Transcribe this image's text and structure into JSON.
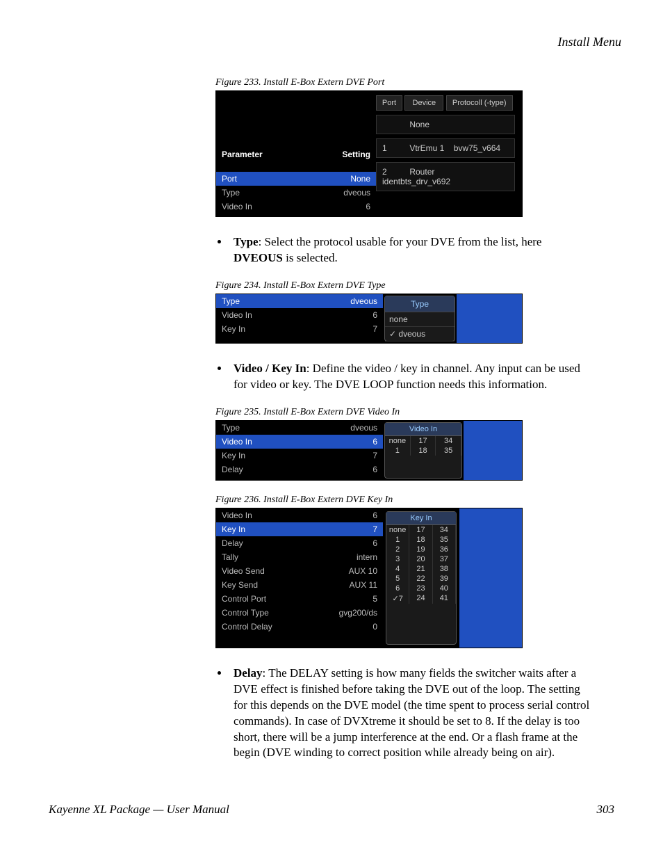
{
  "header": {
    "section_title": "Install Menu"
  },
  "fig233": {
    "caption": "Figure 233.  Install E-Box Extern DVE Port",
    "col_param": "Parameter",
    "col_setting": "Setting",
    "rows": [
      {
        "label": "Port",
        "value": "None",
        "selected": true
      },
      {
        "label": "Type",
        "value": "dveous",
        "selected": false
      },
      {
        "label": "Video In",
        "value": "6",
        "selected": false
      }
    ],
    "hdr_port": "Port",
    "hdr_device": "Device",
    "hdr_protocol": "Protocoll (-type)",
    "options": [
      {
        "port": "",
        "device": "None",
        "proto": ""
      },
      {
        "port": "1",
        "device": "VtrEmu 1",
        "proto": "bvw75_v664"
      },
      {
        "port": "2",
        "device": "Router",
        "proto": "identbts_drv_v692"
      }
    ]
  },
  "para_type": {
    "lead": "Type",
    "rest": ": Select the protocol usable for your DVE from the list, here ",
    "bold2": "DVEOUS",
    "rest2": " is selected."
  },
  "fig234": {
    "caption": "Figure 234.  Install E-Box Extern DVE Type",
    "rows": [
      {
        "label": "Type",
        "value": "dveous",
        "selected": true
      },
      {
        "label": "Video In",
        "value": "6",
        "selected": false
      },
      {
        "label": "Key In",
        "value": "7",
        "selected": false
      }
    ],
    "panel_title": "Type",
    "opt_none": "none",
    "opt_sel": "✓ dveous"
  },
  "para_videokey": {
    "lead": "Video / Key In",
    "rest": ": Define the video / key in channel. Any input can be used for video or key. The DVE LOOP function needs this information."
  },
  "fig235": {
    "caption": "Figure 235.  Install E-Box Extern DVE Video In",
    "rows": [
      {
        "label": "Type",
        "value": "dveous",
        "selected": false
      },
      {
        "label": "Video In",
        "value": "6",
        "selected": true
      },
      {
        "label": "Key In",
        "value": "7",
        "selected": false
      },
      {
        "label": "Delay",
        "value": "6",
        "selected": false
      }
    ],
    "panel_title": "Video In",
    "grid": [
      [
        "none",
        "17",
        "34"
      ],
      [
        "1",
        "18",
        "35"
      ]
    ]
  },
  "fig236": {
    "caption": "Figure 236.  Install E-Box Extern DVE Key In",
    "rows": [
      {
        "label": "Video In",
        "value": "6",
        "selected": false
      },
      {
        "label": "Key In",
        "value": "7",
        "selected": true
      },
      {
        "label": "Delay",
        "value": "6",
        "selected": false
      },
      {
        "label": "Tally",
        "value": "intern",
        "selected": false
      },
      {
        "label": "Video Send",
        "value": "AUX 10",
        "selected": false
      },
      {
        "label": "Key Send",
        "value": "AUX 11",
        "selected": false
      },
      {
        "label": "Control Port",
        "value": "5",
        "selected": false
      },
      {
        "label": "Control Type",
        "value": "gvg200/ds",
        "selected": false
      },
      {
        "label": "Control Delay",
        "value": "0",
        "selected": false
      }
    ],
    "panel_title": "Key In",
    "grid": [
      [
        "none",
        "17",
        "34"
      ],
      [
        "1",
        "18",
        "35"
      ],
      [
        "2",
        "19",
        "36"
      ],
      [
        "3",
        "20",
        "37"
      ],
      [
        "4",
        "21",
        "38"
      ],
      [
        "5",
        "22",
        "39"
      ],
      [
        "6",
        "23",
        "40"
      ],
      [
        "✓7",
        "24",
        "41"
      ]
    ]
  },
  "para_delay": {
    "lead": "Delay",
    "rest": ": The DELAY setting is how many fields the switcher waits after a DVE effect is finished before taking the DVE out of the loop. The setting for this depends on the DVE model (the time spent to process serial control commands). In case of DVXtreme it should be set to 8. If the delay is too short, there will be a jump interference at the end. Or a flash frame at the begin (DVE winding to correct position while already being on air)."
  },
  "footer": {
    "left": "Kayenne XL Package — User Manual",
    "right": "303"
  }
}
